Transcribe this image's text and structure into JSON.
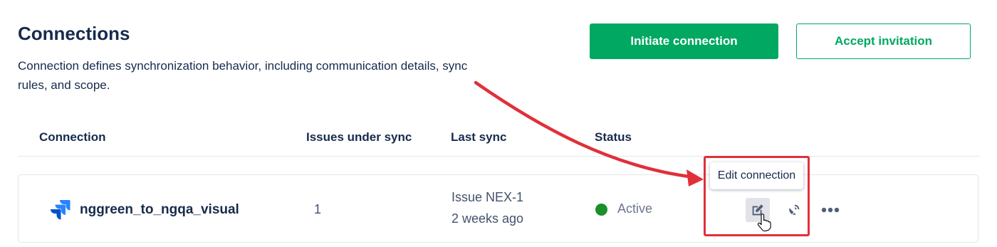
{
  "header": {
    "title": "Connections",
    "description": "Connection defines synchronization behavior, including communication details, sync rules, and scope."
  },
  "actions": {
    "initiate_label": "Initiate connection",
    "accept_label": "Accept invitation"
  },
  "table": {
    "columns": [
      "Connection",
      "Issues under sync",
      "Last sync",
      "Status"
    ],
    "rows": [
      {
        "name": "nggreen_to_ngqa_visual",
        "issues": "1",
        "last_sync_issue": "Issue NEX-1",
        "last_sync_time": "2 weeks ago",
        "status": "Active",
        "icon": "jira-icon"
      }
    ]
  },
  "row_actions": {
    "edit_icon": "edit-icon",
    "sync_icon": "satellite-dish-icon",
    "more_icon": "more-horizontal-icon"
  },
  "tooltip": {
    "text": "Edit connection"
  },
  "colors": {
    "primary": "#00a862",
    "status_active": "#1a8f2a",
    "annotation": "#e0303a",
    "text": "#172b4d"
  }
}
